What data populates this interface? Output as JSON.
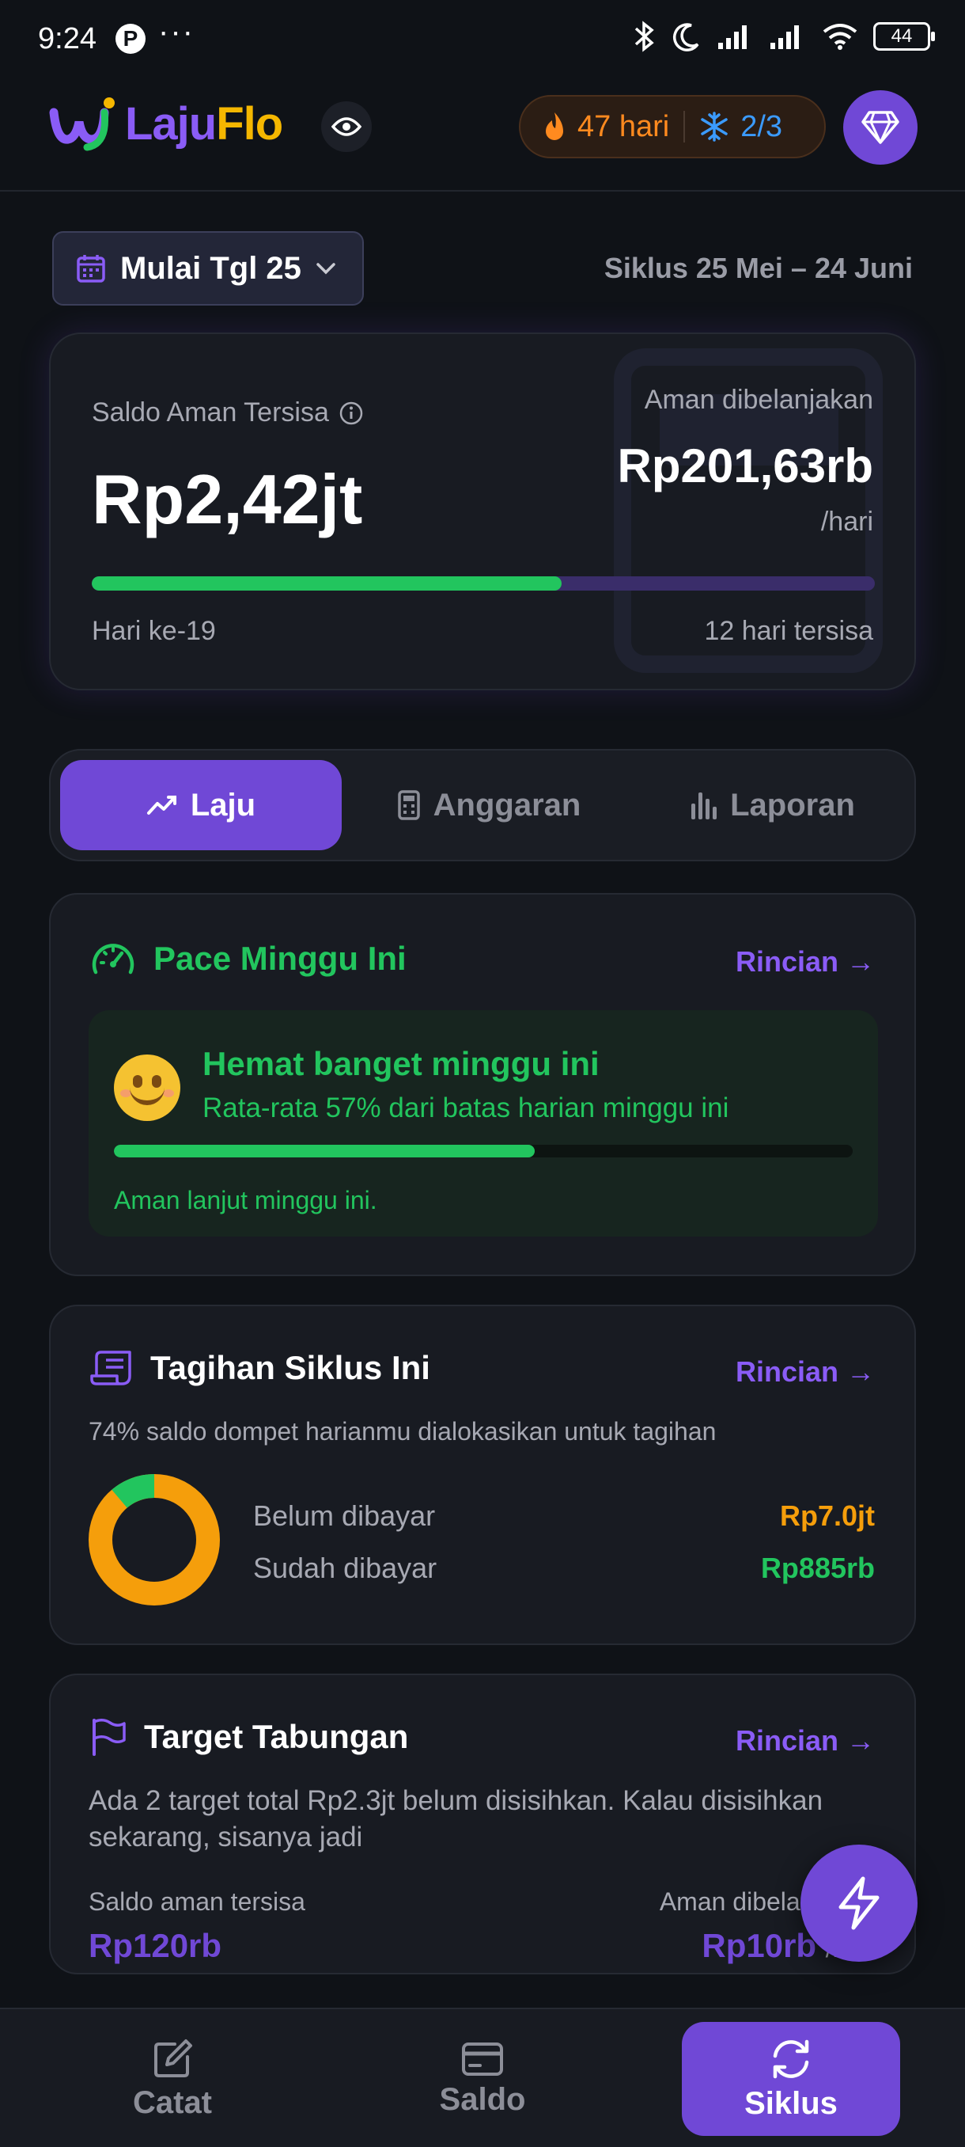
{
  "status_bar": {
    "time": "9:24",
    "dots": "···",
    "battery": "44"
  },
  "header": {
    "logo_part1": "Laju",
    "logo_part2": "Flo",
    "streak_days": "47 hari",
    "freeze_count": "2/3",
    "colors": {
      "brand_purple": "#7048d6",
      "brand_yellow": "#f5b700",
      "streak_orange": "#ff8a1f",
      "freeze_blue": "#3b9bff"
    }
  },
  "cycle": {
    "button_label": "Mulai Tgl 25",
    "range": "Siklus 25 Mei – 24 Juni"
  },
  "balance": {
    "label": "Saldo Aman Tersisa",
    "amount": "Rp2,42jt",
    "safe_label": "Aman dibelanjakan",
    "safe_amount": "Rp201,63rb",
    "per_day": "/hari",
    "progress_fraction": 0.6,
    "day_label": "Hari ke-19",
    "days_left": "12 hari tersisa"
  },
  "tabs": [
    {
      "label": "Laju",
      "active": true,
      "icon": "trend-icon"
    },
    {
      "label": "Anggaran",
      "active": false,
      "icon": "calculator-icon"
    },
    {
      "label": "Laporan",
      "active": false,
      "icon": "bar-chart-icon"
    }
  ],
  "pace": {
    "title": "Pace Minggu Ini",
    "rincian": "Rincian →",
    "headline": "Hemat banget minggu ini",
    "subline": "Rata-rata 57% dari batas harian minggu ini",
    "progress_fraction": 0.57,
    "note": "Aman lanjut minggu ini."
  },
  "bills": {
    "title": "Tagihan Siklus Ini",
    "rincian": "Rincian →",
    "subtitle": "74% saldo dompet harianmu dialokasikan untuk tagihan",
    "unpaid_label": "Belum dibayar",
    "unpaid_value": "Rp7.0jt",
    "paid_label": "Sudah dibayar",
    "paid_value": "Rp885rb",
    "paid_fraction": 0.112,
    "colors": {
      "unpaid": "#f59e0b",
      "paid": "#22c55e"
    }
  },
  "savings": {
    "title": "Target Tabungan",
    "rincian": "Rincian →",
    "description": "Ada 2 target total Rp2.3jt belum disisihkan. Kalau disisihkan sekarang, sisanya jadi",
    "left_label": "Saldo aman tersisa",
    "left_value": "Rp120rb",
    "right_label": "Aman dibelanjakan",
    "right_value": "Rp10rb",
    "right_suffix": "/hari"
  },
  "bottom_nav": [
    {
      "label": "Catat",
      "active": false,
      "icon": "edit-icon"
    },
    {
      "label": "Saldo",
      "active": false,
      "icon": "card-icon"
    },
    {
      "label": "Siklus",
      "active": true,
      "icon": "cycle-icon"
    }
  ]
}
